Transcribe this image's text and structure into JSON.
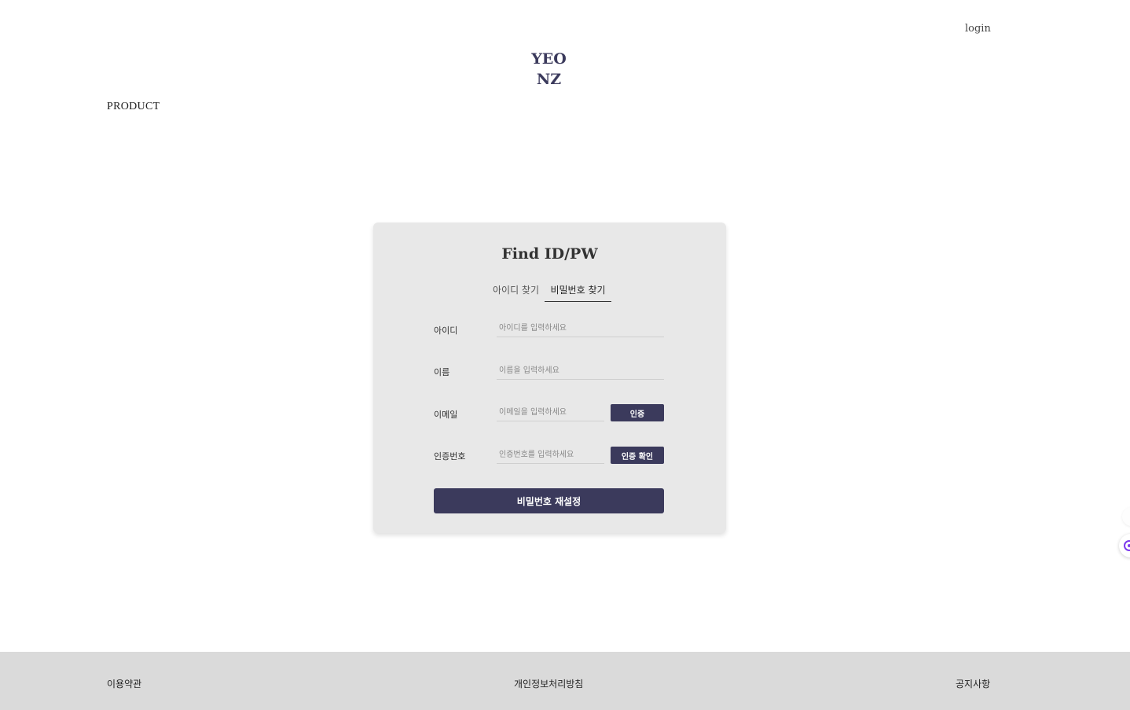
{
  "header": {
    "login_label": "login",
    "logo_line1": "YEO",
    "logo_line2": "NZ",
    "nav_product": "PRODUCT"
  },
  "card": {
    "title": "Find ID/PW",
    "tabs": [
      {
        "label": "아이디 찾기",
        "active": false
      },
      {
        "label": "비밀번호 찾기",
        "active": true
      }
    ],
    "fields": [
      {
        "label": "아이디",
        "placeholder": "아이디를 입력하세요",
        "value": ""
      },
      {
        "label": "이름",
        "placeholder": "이름을 입력하세요",
        "value": ""
      },
      {
        "label": "이메일",
        "placeholder": "이메일을 입력하세요",
        "value": "",
        "button": "인증"
      },
      {
        "label": "인증번호",
        "placeholder": "인증번호를 입력하세요",
        "value": "",
        "button": "인증 확인"
      }
    ],
    "submit_label": "비밀번호 재설정"
  },
  "footer": {
    "links": [
      "이용약관",
      "개인정보처리방침",
      "공지사항"
    ]
  },
  "colors": {
    "accent": "#3b3a5c",
    "card_bg": "#e8e8e8",
    "footer_bg": "#dadada",
    "widget_icon": "#7c3aed"
  },
  "icons": {
    "side_widget": "chat-widget-icon"
  }
}
